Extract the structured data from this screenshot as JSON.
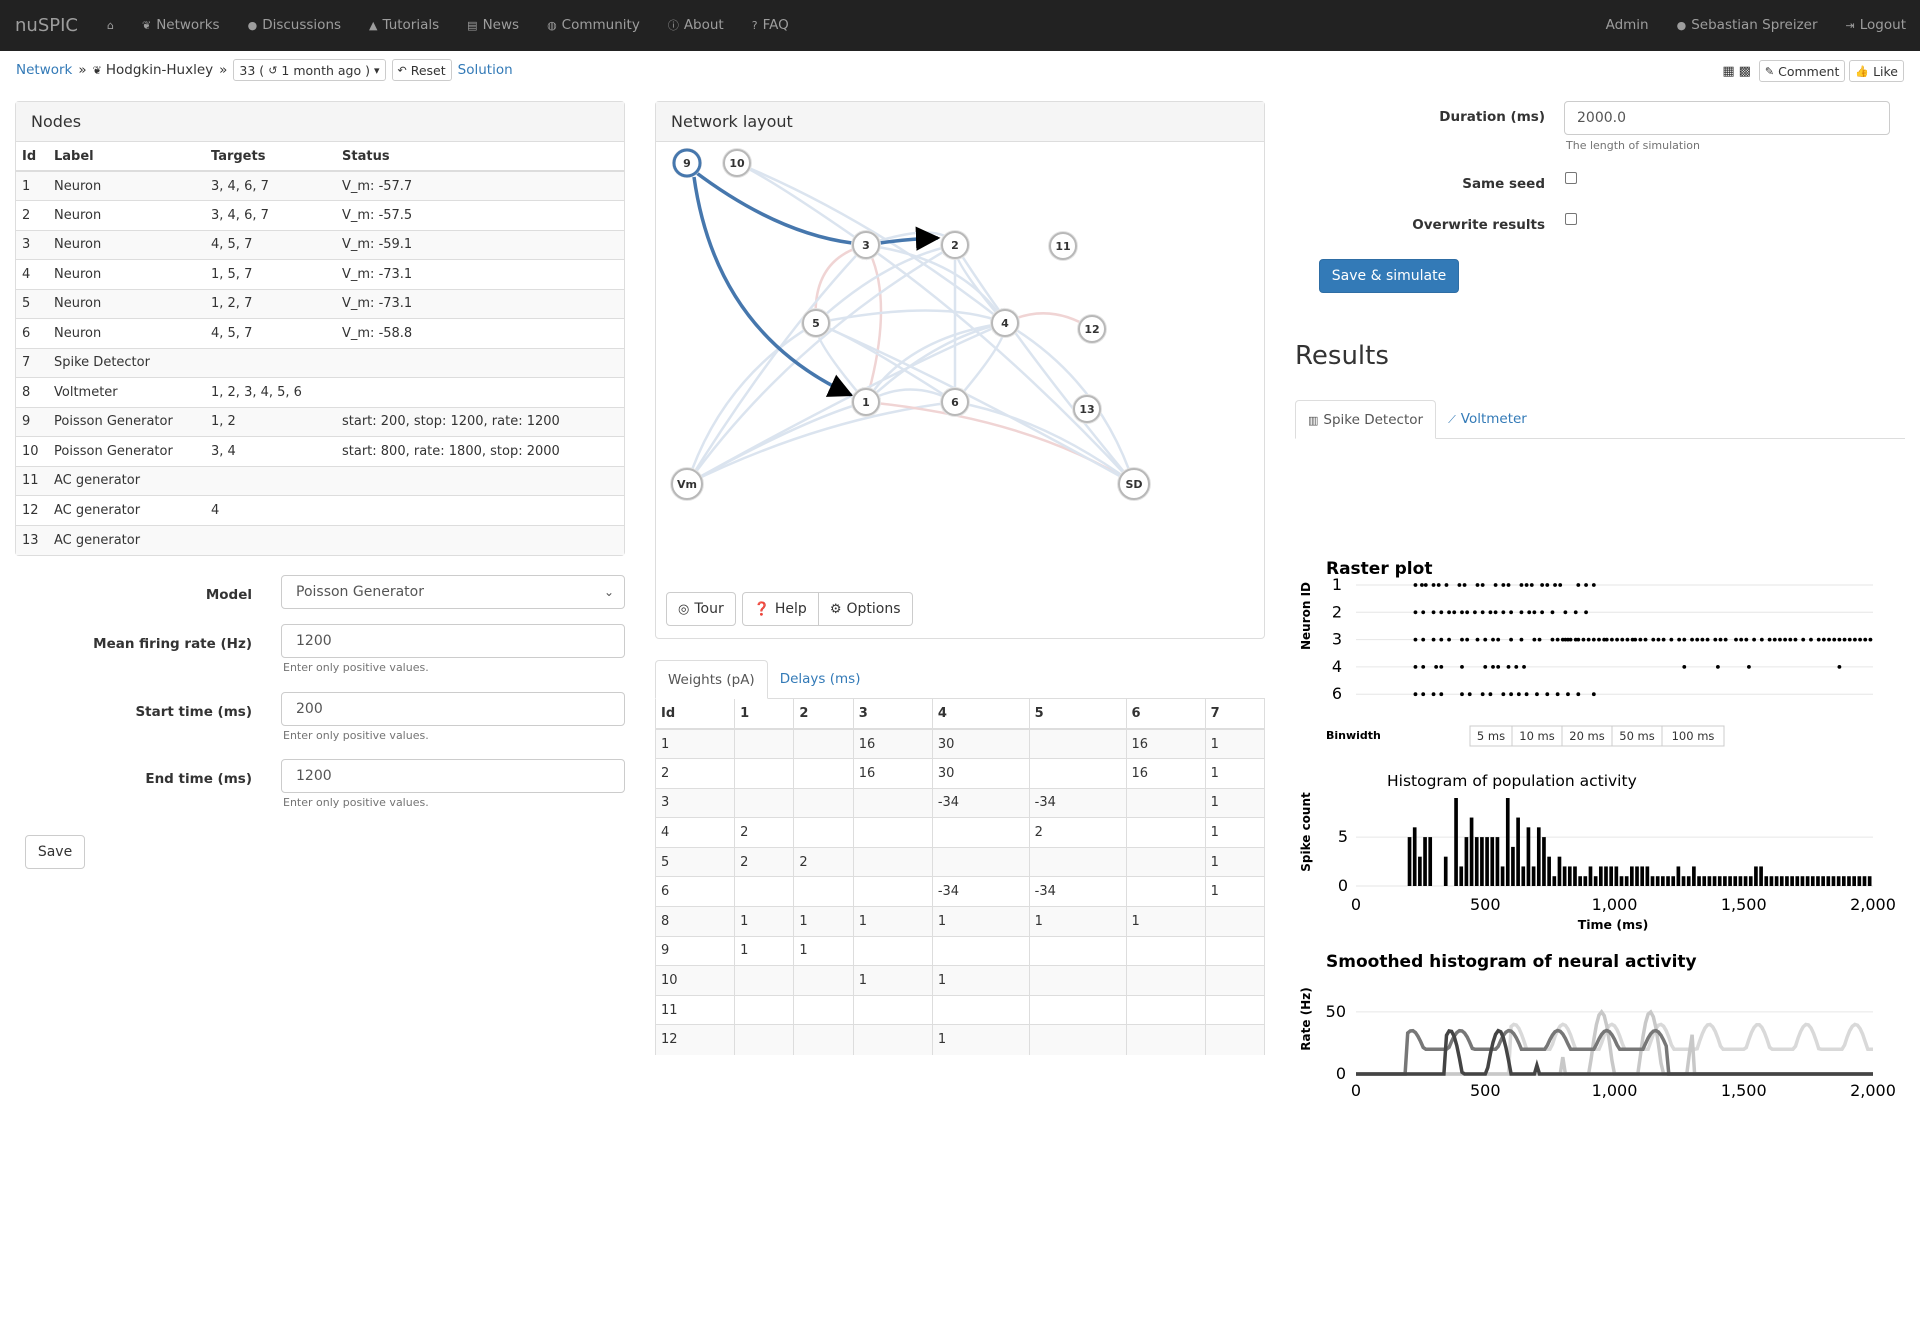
{
  "nav": {
    "brand": "nuSPIC",
    "items": [
      {
        "icon": "home-icon",
        "label": ""
      },
      {
        "icon": "leaf-icon",
        "label": "Networks"
      },
      {
        "icon": "bulb-icon",
        "label": "Discussions"
      },
      {
        "icon": "graduation-cap-icon",
        "label": "Tutorials"
      },
      {
        "icon": "newspaper-icon",
        "label": "News"
      },
      {
        "icon": "users-icon",
        "label": "Community"
      },
      {
        "icon": "info-icon",
        "label": "About"
      },
      {
        "icon": "question-icon",
        "label": "FAQ"
      }
    ],
    "right": [
      {
        "icon": "",
        "label": "Admin"
      },
      {
        "icon": "user-icon",
        "label": "Sebastian Spreizer"
      },
      {
        "icon": "logout-icon",
        "label": "Logout"
      }
    ]
  },
  "breadcrumb": {
    "root": "Network",
    "network": "Hodgkin-Huxley",
    "version": "33 (",
    "version_time": "1 month ago )",
    "reset": "Reset",
    "solution": "Solution",
    "comment": "Comment",
    "like": "Like"
  },
  "nodes": {
    "title": "Nodes",
    "columns": [
      "Id",
      "Label",
      "Targets",
      "Status"
    ],
    "rows": [
      [
        "1",
        "Neuron",
        "3, 4, 6, 7",
        "V_m: -57.7"
      ],
      [
        "2",
        "Neuron",
        "3, 4, 6, 7",
        "V_m: -57.5"
      ],
      [
        "3",
        "Neuron",
        "4, 5, 7",
        "V_m: -59.1"
      ],
      [
        "4",
        "Neuron",
        "1, 5, 7",
        "V_m: -73.1"
      ],
      [
        "5",
        "Neuron",
        "1, 2, 7",
        "V_m: -73.1"
      ],
      [
        "6",
        "Neuron",
        "4, 5, 7",
        "V_m: -58.8"
      ],
      [
        "7",
        "Spike Detector",
        "",
        ""
      ],
      [
        "8",
        "Voltmeter",
        "1, 2, 3, 4, 5, 6",
        ""
      ],
      [
        "9",
        "Poisson Generator",
        "1, 2",
        "start: 200, stop: 1200, rate: 1200"
      ],
      [
        "10",
        "Poisson Generator",
        "3, 4",
        "start: 800, rate: 1800, stop: 2000"
      ],
      [
        "11",
        "AC generator",
        "",
        ""
      ],
      [
        "12",
        "AC generator",
        "4",
        ""
      ],
      [
        "13",
        "AC generator",
        "",
        ""
      ]
    ]
  },
  "form": {
    "model_label": "Model",
    "model_value": "Poisson Generator",
    "rate_label": "Mean firing rate (Hz)",
    "rate_value": "1200",
    "rate_help": "Enter only positive values.",
    "start_label": "Start time (ms)",
    "start_value": "200",
    "start_help": "Enter only positive values.",
    "end_label": "End time (ms)",
    "end_value": "1200",
    "end_help": "Enter only positive values.",
    "save": "Save"
  },
  "graph": {
    "title": "Network layout",
    "tour": "Tour",
    "help": "Help",
    "options": "Options",
    "nodes": [
      {
        "id": "9",
        "label": "9",
        "selected": true
      },
      {
        "id": "10",
        "label": "10"
      },
      {
        "id": "3",
        "label": "3"
      },
      {
        "id": "2",
        "label": "2"
      },
      {
        "id": "11",
        "label": "11"
      },
      {
        "id": "5",
        "label": "5"
      },
      {
        "id": "4",
        "label": "4"
      },
      {
        "id": "12",
        "label": "12"
      },
      {
        "id": "1",
        "label": "1"
      },
      {
        "id": "6",
        "label": "6"
      },
      {
        "id": "13",
        "label": "13"
      },
      {
        "id": "vm",
        "label": "Vm"
      },
      {
        "id": "sd",
        "label": "SD"
      }
    ]
  },
  "weights": {
    "tab_weights": "Weights (pA)",
    "tab_delays": "Delays (ms)",
    "columns": [
      "Id",
      "1",
      "2",
      "3",
      "4",
      "5",
      "6",
      "7"
    ],
    "rows": [
      [
        "1",
        "",
        "",
        "16",
        "30",
        "",
        "16",
        "1"
      ],
      [
        "2",
        "",
        "",
        "16",
        "30",
        "",
        "16",
        "1"
      ],
      [
        "3",
        "",
        "",
        "",
        "-34",
        "-34",
        "",
        "1"
      ],
      [
        "4",
        "2",
        "",
        "",
        "",
        "2",
        "",
        "1"
      ],
      [
        "5",
        "2",
        "2",
        "",
        "",
        "",
        "",
        "1"
      ],
      [
        "6",
        "",
        "",
        "",
        "-34",
        "-34",
        "",
        "1"
      ],
      [
        "8",
        "1",
        "1",
        "1",
        "1",
        "1",
        "1",
        ""
      ],
      [
        "9",
        "1",
        "1",
        "",
        "",
        "",
        "",
        ""
      ],
      [
        "10",
        "",
        "",
        "1",
        "1",
        "",
        "",
        ""
      ],
      [
        "11",
        "",
        "",
        "",
        "",
        "",
        "",
        ""
      ],
      [
        "12",
        "",
        "",
        "",
        "1",
        "",
        "",
        ""
      ]
    ]
  },
  "sim": {
    "duration_label": "Duration (ms)",
    "duration_value": "2000.0",
    "duration_help": "The length of simulation",
    "seed_label": "Same seed",
    "overwrite_label": "Overwrite results",
    "button": "Save & simulate"
  },
  "results": {
    "title": "Results",
    "tab_sd": "Spike Detector",
    "tab_vm": "Voltmeter",
    "binwidth_label": "Binwidth",
    "binwidths": [
      "5 ms",
      "10 ms",
      "20 ms",
      "50 ms",
      "100 ms"
    ]
  },
  "chart_data": [
    {
      "type": "scatter",
      "title": "Raster plot",
      "ylabel": "Neuron ID",
      "categories": [
        "1",
        "2",
        "3",
        "4",
        "6"
      ],
      "xlim": [
        0,
        2000
      ],
      "series": [
        {
          "id": "1",
          "x": [
            230,
            255,
            270,
            300,
            320,
            350,
            400,
            420,
            470,
            490,
            540,
            570,
            590,
            640,
            660,
            680,
            720,
            740,
            770,
            790,
            860,
            890,
            920
          ]
        },
        {
          "id": "2",
          "x": [
            230,
            260,
            300,
            330,
            360,
            380,
            410,
            430,
            460,
            490,
            520,
            540,
            570,
            600,
            640,
            670,
            690,
            720,
            760,
            810,
            850,
            890
          ]
        },
        {
          "id": "3",
          "x": [
            230,
            260,
            300,
            330,
            360,
            410,
            430,
            470,
            500,
            530,
            550,
            600,
            640,
            690,
            710,
            760,
            780,
            800,
            810,
            820,
            830,
            850,
            860,
            880,
            900,
            920,
            940,
            960,
            970,
            990,
            1010,
            1030,
            1050,
            1070,
            1080,
            1100,
            1120,
            1150,
            1170,
            1190,
            1220,
            1250,
            1270,
            1300,
            1320,
            1340,
            1360,
            1390,
            1410,
            1430,
            1470,
            1490,
            1510,
            1540,
            1570,
            1600,
            1620,
            1640,
            1660,
            1680,
            1700,
            1730,
            1760,
            1790,
            1810,
            1830,
            1850,
            1870,
            1890,
            1910,
            1930,
            1950,
            1970,
            1990
          ]
        },
        {
          "id": "4",
          "x": [
            230,
            260,
            310,
            330,
            410,
            500,
            530,
            550,
            590,
            620,
            650,
            1270,
            1400,
            1520,
            1870
          ]
        },
        {
          "id": "6",
          "x": [
            230,
            260,
            300,
            330,
            410,
            440,
            490,
            520,
            570,
            600,
            630,
            660,
            700,
            740,
            780,
            820,
            860,
            920
          ]
        }
      ]
    },
    {
      "type": "bar",
      "title": "Histogram of population activity",
      "xlabel": "Time (ms)",
      "ylabel": "Spike count",
      "xlim": [
        0,
        2000
      ],
      "ylim": [
        0,
        9
      ],
      "xticks": [
        "0",
        "500",
        "1,000",
        "1,500",
        "2,000"
      ],
      "yticks": [
        "0",
        "5"
      ],
      "bin_start": 200,
      "binwidth": 20,
      "values": [
        5,
        6,
        3,
        5,
        5,
        0,
        0,
        3,
        0,
        9,
        2,
        5,
        7,
        5,
        5,
        5,
        5,
        5,
        2,
        9,
        4,
        7,
        2,
        6,
        2,
        6,
        5,
        3,
        1,
        3,
        2,
        2,
        2,
        1,
        1,
        2,
        1,
        2,
        2,
        2,
        2,
        1,
        1,
        2,
        2,
        2,
        2,
        1,
        1,
        1,
        1,
        1,
        2,
        1,
        1,
        2,
        1,
        1,
        1,
        1,
        1,
        1,
        1,
        1,
        1,
        1,
        1,
        2,
        2,
        1,
        1,
        1,
        1,
        1,
        1,
        1,
        1,
        1,
        1,
        1,
        1,
        1,
        1,
        1,
        1,
        1,
        1,
        1,
        1,
        1,
        1,
        1
      ]
    },
    {
      "type": "line",
      "title": "Smoothed histogram of neural activity",
      "ylabel": "Rate (Hz)",
      "xlim": [
        0,
        2000
      ],
      "ylim": [
        0,
        60
      ],
      "xticks": [
        "0",
        "500",
        "1,000",
        "1,500",
        "2,000"
      ],
      "yticks": [
        "0",
        "50"
      ]
    }
  ]
}
